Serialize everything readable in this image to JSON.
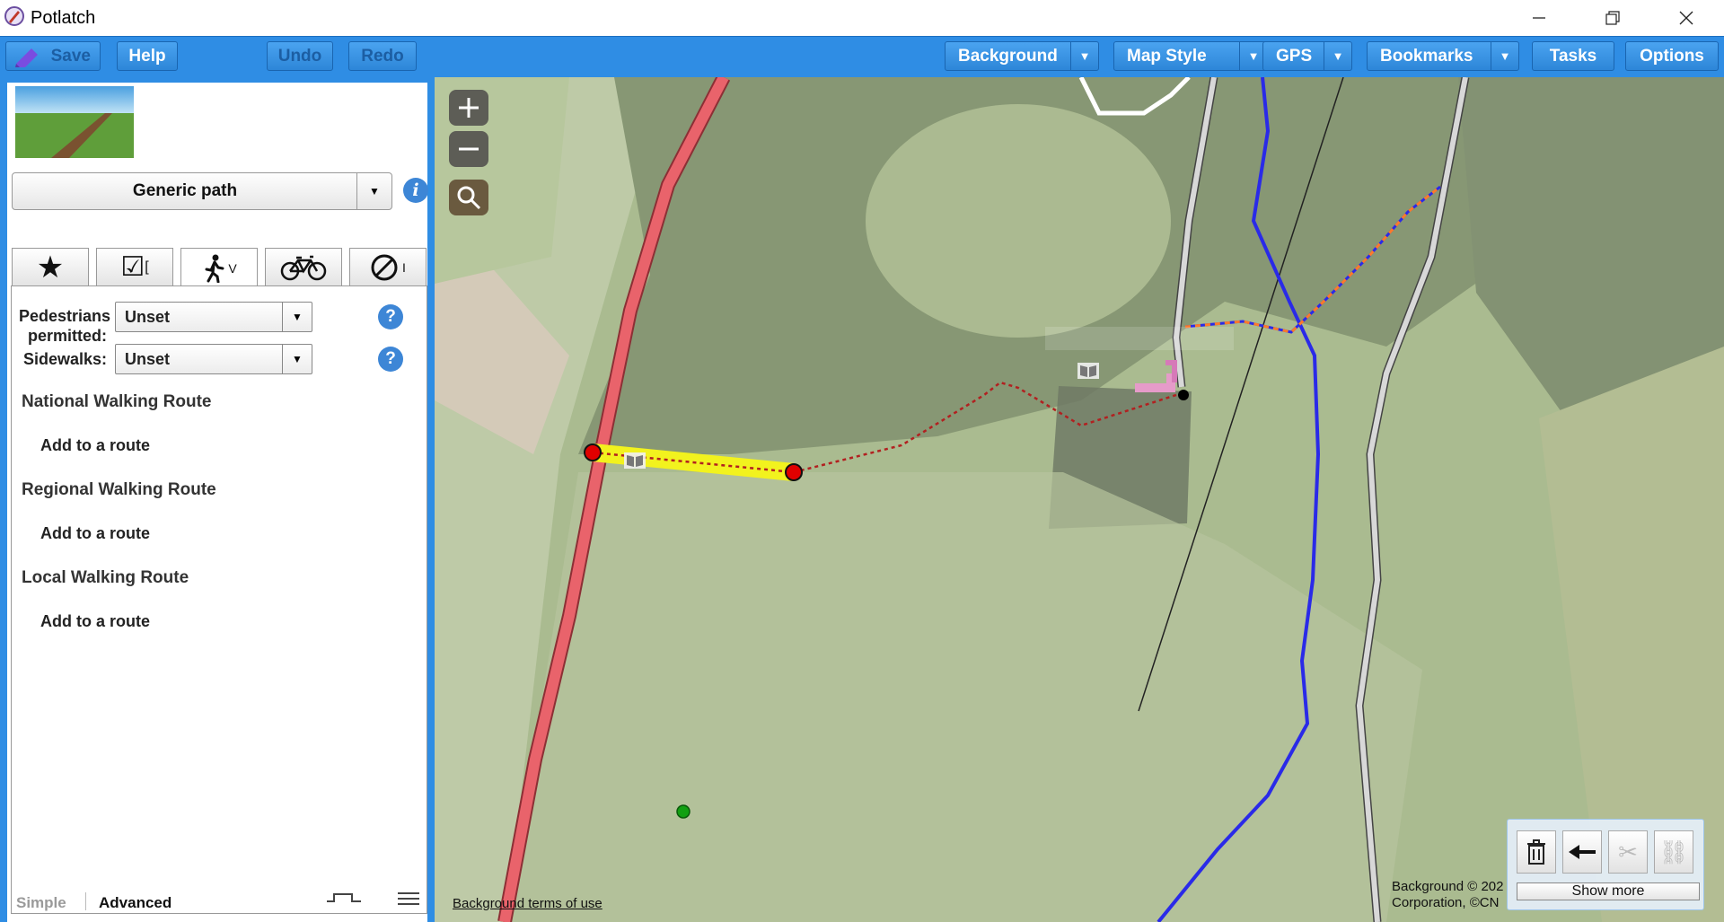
{
  "window": {
    "title": "Potlatch",
    "controls": [
      "minimize-icon",
      "restore-icon",
      "close-icon"
    ]
  },
  "toolbar": {
    "save": "Save",
    "help": "Help",
    "undo": "Undo",
    "redo": "Redo",
    "background": "Background",
    "map_style": "Map Style",
    "gps": "GPS",
    "bookmarks": "Bookmarks",
    "tasks": "Tasks",
    "options": "Options"
  },
  "sidebar": {
    "preset": "Generic path",
    "tabs": [
      {
        "icon": "star-icon",
        "suffix": ""
      },
      {
        "icon": "checkbox-icon",
        "suffix": "["
      },
      {
        "icon": "pedestrian-icon",
        "suffix": "V"
      },
      {
        "icon": "bicycle-icon",
        "suffix": ""
      },
      {
        "icon": "no-entry-icon",
        "suffix": "I"
      }
    ],
    "fields": [
      {
        "label_line1": "Pedestrians",
        "label_line2": "permitted:",
        "value": "Unset"
      },
      {
        "label": "Sidewalks:",
        "value": "Unset"
      }
    ],
    "routes": [
      {
        "heading": "National Walking Route",
        "action": "Add to a route"
      },
      {
        "heading": "Regional Walking Route",
        "action": "Add to a route"
      },
      {
        "heading": "Local Walking Route",
        "action": "Add to a route"
      }
    ],
    "mode_simple": "Simple",
    "mode_advanced": "Advanced"
  },
  "map": {
    "zoom_in": "+",
    "zoom_out": "−",
    "terms": "Background terms of use",
    "attribution_line1": "Background © 202",
    "attribution_line2": "Corporation, ©CN",
    "show_more": "Show more"
  },
  "colors": {
    "toolbar": "#2f8de4",
    "selected_way": "#f2f21e",
    "road": "#e9636b",
    "route": "#2a2ae8",
    "node": "#e00000"
  }
}
